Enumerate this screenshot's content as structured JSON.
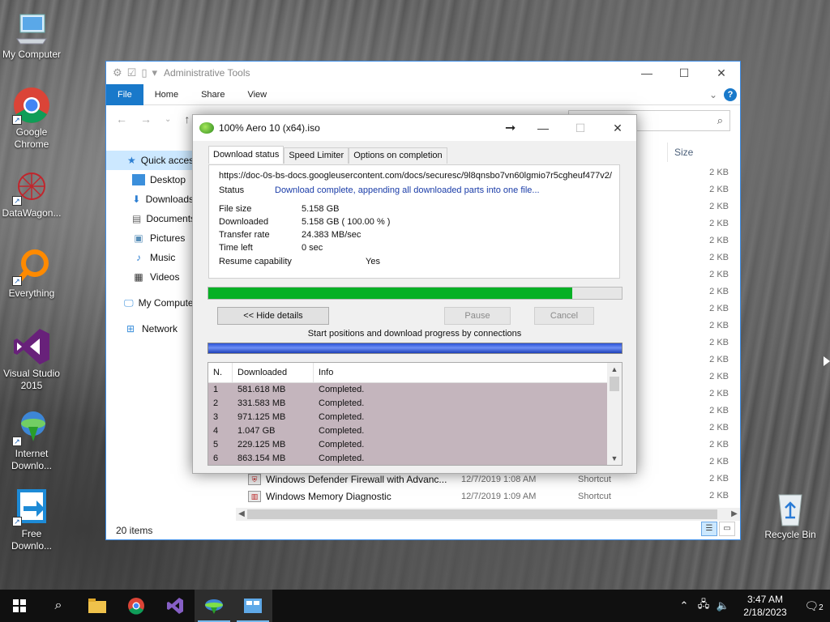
{
  "desktop": {
    "icons": [
      {
        "label": "My Computer",
        "icon": "monitor-icon"
      },
      {
        "label": "Google Chrome",
        "icon": "chrome-icon"
      },
      {
        "label": "DataWagon...",
        "icon": "datawagon-icon"
      },
      {
        "label": "Everything",
        "icon": "everything-icon"
      },
      {
        "label": "Visual Studio 2015",
        "icon": "visual-studio-icon"
      },
      {
        "label": "Internet Downlo...",
        "icon": "idm-icon"
      },
      {
        "label": "Free Downlo...",
        "icon": "free-download-icon"
      },
      {
        "label": "Recycle Bin",
        "icon": "recycle-bin-icon"
      }
    ]
  },
  "explorer": {
    "title": "Administrative Tools",
    "ribbon_tabs": [
      "File",
      "Home",
      "Share",
      "View"
    ],
    "nav": [
      {
        "label": "Quick access",
        "icon": "star-icon"
      },
      {
        "label": "Desktop",
        "icon": "desktop-icon"
      },
      {
        "label": "Downloads",
        "icon": "download-arrow-icon"
      },
      {
        "label": "Documents",
        "icon": "document-icon"
      },
      {
        "label": "Pictures",
        "icon": "pictures-icon"
      },
      {
        "label": "Music",
        "icon": "music-note-icon"
      },
      {
        "label": "Videos",
        "icon": "film-icon"
      },
      {
        "label": "My Computer",
        "icon": "monitor-icon"
      },
      {
        "label": "Network",
        "icon": "network-icon"
      }
    ],
    "size_header": "Size",
    "sizes": [
      "2 KB",
      "2 KB",
      "2 KB",
      "2 KB",
      "2 KB",
      "2 KB",
      "2 KB",
      "2 KB",
      "2 KB",
      "2 KB",
      "2 KB",
      "2 KB",
      "2 KB",
      "2 KB",
      "2 KB",
      "2 KB",
      "2 KB",
      "2 KB",
      "2 KB",
      "2 KB"
    ],
    "visible_files": [
      {
        "name": "Windows Defender Firewall with Advanc...",
        "date": "12/7/2019 1:08 AM",
        "type": "Shortcut"
      },
      {
        "name": "Windows Memory Diagnostic",
        "date": "12/7/2019 1:09 AM",
        "type": "Shortcut"
      }
    ],
    "status": "20 items"
  },
  "idm": {
    "title": "100% Aero 10 (x64).iso",
    "tabs": [
      "Download status",
      "Speed Limiter",
      "Options on completion"
    ],
    "url": "https://doc-0s-bs-docs.googleusercontent.com/docs/securesc/9l8qnsbo7vn60lgmio7r5cgheuf477v2/",
    "status_label": "Status",
    "status_value": "Download complete, appending all downloaded parts into one file...",
    "file_size_label": "File size",
    "file_size": "5.158  GB",
    "downloaded_label": "Downloaded",
    "downloaded": "5.158  GB  ( 100.00 % )",
    "rate_label": "Transfer rate",
    "rate": "24.383  MB/sec",
    "time_left_label": "Time left",
    "time_left": "0 sec",
    "resume_label": "Resume capability",
    "resume": "Yes",
    "progress_fraction": 0.88,
    "hide_details": "<< Hide details",
    "pause": "Pause",
    "cancel": "Cancel",
    "connections_caption": "Start positions and download progress by connections",
    "columns": [
      "N.",
      "Downloaded",
      "Info"
    ],
    "connections": [
      {
        "n": "1",
        "downloaded": "581.618  MB",
        "info": "Completed."
      },
      {
        "n": "2",
        "downloaded": "331.583  MB",
        "info": "Completed."
      },
      {
        "n": "3",
        "downloaded": "971.125  MB",
        "info": "Completed."
      },
      {
        "n": "4",
        "downloaded": "1.047  GB",
        "info": "Completed."
      },
      {
        "n": "5",
        "downloaded": "229.125  MB",
        "info": "Completed."
      },
      {
        "n": "6",
        "downloaded": "863.154  MB",
        "info": "Completed."
      }
    ]
  },
  "taskbar": {
    "time": "3:47 AM",
    "date": "2/18/2023",
    "notifications": "2"
  }
}
